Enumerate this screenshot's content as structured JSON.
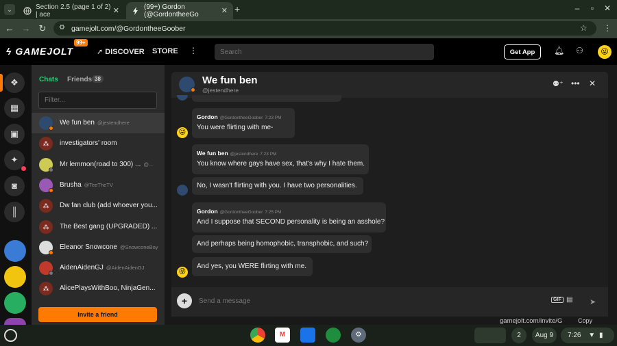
{
  "browser": {
    "tabs": [
      {
        "title": "Section 2.5 (page 1 of 2) | ace",
        "close": "✕"
      },
      {
        "title": "(99+) Gordon (@GordontheeGo",
        "close": "✕"
      }
    ],
    "new_tab": "+",
    "url": "gamejolt.com/@GordontheeGoober"
  },
  "header": {
    "logo": "GAMEJOLT",
    "notif_badge": "99+",
    "discover": "DISCOVER",
    "store": "STORE",
    "search_placeholder": "Search",
    "get_app": "Get App"
  },
  "sidebar": {
    "tab_chats": "Chats",
    "tab_friends": "Friends",
    "friend_count": "38",
    "filter_placeholder": "Filter...",
    "items": [
      {
        "name": "We fun ben",
        "handle": "@jestendhere",
        "selected": true,
        "status": "#ff7a00",
        "avatar": "#2e4a6e",
        "glyph": "",
        "group": false
      },
      {
        "name": "investigators' room",
        "handle": "",
        "selected": false,
        "status": "",
        "avatar": "",
        "glyph": "⁂",
        "group": true
      },
      {
        "name": "Mr lemmon(road to 300) ...",
        "handle": "@...",
        "selected": false,
        "status": "#777777",
        "avatar": "#cccc55",
        "glyph": "",
        "group": false
      },
      {
        "name": "Brusha",
        "handle": "@TeeTheTV",
        "selected": false,
        "status": "#ff7a00",
        "avatar": "#9b59b6",
        "glyph": "",
        "group": false
      },
      {
        "name": "Dw fan club (add whoever you...",
        "handle": "",
        "selected": false,
        "status": "",
        "avatar": "",
        "glyph": "⁂",
        "group": true
      },
      {
        "name": "The Best gang (UPGRADED) ...",
        "handle": "",
        "selected": false,
        "status": "",
        "avatar": "",
        "glyph": "⁂",
        "group": true
      },
      {
        "name": "Eleanor Snowcone",
        "handle": "@SnowconeBoy",
        "selected": false,
        "status": "#ff7a00",
        "avatar": "#dddddd",
        "glyph": "",
        "group": false
      },
      {
        "name": "AidenAidenGJ",
        "handle": "@AidenAidenGJ",
        "selected": false,
        "status": "#777777",
        "avatar": "#c0392b",
        "glyph": "",
        "group": false
      },
      {
        "name": "AlicePlaysWithBoo, NinjaGen...",
        "handle": "",
        "selected": false,
        "status": "",
        "avatar": "",
        "glyph": "⁂",
        "group": true
      }
    ],
    "invite": "Invite a friend"
  },
  "chat": {
    "title": "We fun ben",
    "handle": "@jestendhere",
    "messages": [
      {
        "author": "Gordon",
        "handle": "@GordontheeGoober",
        "time": "7:23 PM",
        "text": "You were flirting with me-"
      },
      {
        "author": "We fun ben",
        "handle": "@jestendhere",
        "time": "7:23 PM",
        "text": "You know where gays have sex, that's why I hate them."
      },
      {
        "author": "",
        "handle": "",
        "time": "",
        "text": "No, I wasn't flirting with you. I have two personalities."
      },
      {
        "author": "Gordon",
        "handle": "@GordontheeGoober",
        "time": "7:25 PM",
        "text": "And I suppose that SECOND personality is being an asshole?"
      },
      {
        "author": "",
        "handle": "",
        "time": "",
        "text": "And perhaps being homophobic, transphobic, and such?"
      },
      {
        "author": "",
        "handle": "",
        "time": "",
        "text": "And yes, you WERE flirting with me."
      }
    ],
    "composer_placeholder": "Send a message",
    "gif": "GIF"
  },
  "behind": {
    "invite_link": "gamejolt.com/invite/G",
    "copy": "Copy"
  },
  "taskbar": {
    "notifications": "2",
    "date": "Aug 9",
    "time": "7:26"
  }
}
